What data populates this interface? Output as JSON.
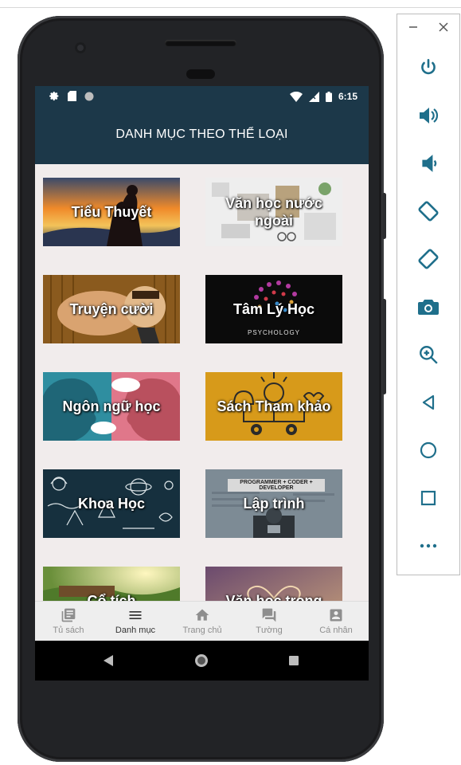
{
  "status_bar": {
    "time": "6:15"
  },
  "appbar": {
    "title": "DANH MỤC THEO THỂ LOẠI"
  },
  "categories": [
    {
      "label": "Tiểu Thuyết"
    },
    {
      "label": "Văn học nước ngoài"
    },
    {
      "label": "Truyện cười"
    },
    {
      "label": "Tâm Lý Học",
      "caption": "PSYCHOLOGY"
    },
    {
      "label": "Ngôn ngữ học"
    },
    {
      "label": "Sách Tham khảo"
    },
    {
      "label": "Khoa Học"
    },
    {
      "label": "Lập trình",
      "banner": "PROGRAMMER + CODER + DEVELOPER"
    },
    {
      "label": "Cổ tích"
    },
    {
      "label": "Văn học trong"
    }
  ],
  "bottom_nav": [
    {
      "label": "Tủ sách",
      "icon": "library-icon"
    },
    {
      "label": "Danh mục",
      "icon": "menu-icon"
    },
    {
      "label": "Trang chủ",
      "icon": "home-icon"
    },
    {
      "label": "Tường",
      "icon": "chat-icon"
    },
    {
      "label": "Cá nhân",
      "icon": "profile-icon"
    }
  ],
  "colors": {
    "appbar": "#1c3849",
    "screen_bg": "#f1ecec",
    "nav_bg": "#eeeeee",
    "emulator_icon": "#1f6f8b"
  }
}
